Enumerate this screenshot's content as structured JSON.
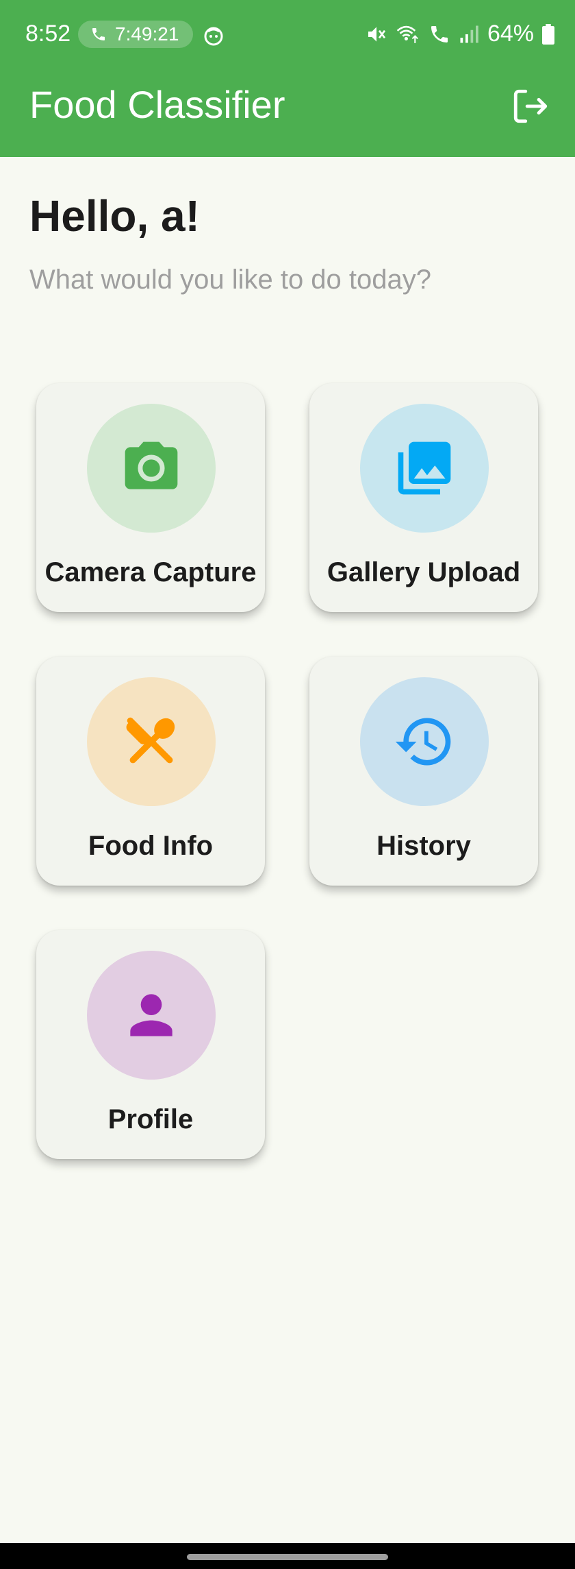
{
  "status_bar": {
    "time": "8:52",
    "call_timer": "7:49:21",
    "battery": "64%"
  },
  "app_bar": {
    "title": "Food Classifier",
    "logout_icon": "logout-icon"
  },
  "greeting": {
    "title": "Hello, a!",
    "subtitle": "What would you like to do today?"
  },
  "menu": [
    {
      "label": "Camera Capture",
      "icon": "camera-icon",
      "color": "#4caf50",
      "bg": "#d3e9d2"
    },
    {
      "label": "Gallery Upload",
      "icon": "photo-library-icon",
      "color": "#03a9f4",
      "bg": "#c7e6ef"
    },
    {
      "label": "Food Info",
      "icon": "restaurant-icon",
      "color": "#ff9800",
      "bg": "#f6e3c1"
    },
    {
      "label": "History",
      "icon": "history-icon",
      "color": "#2196f3",
      "bg": "#c9e1ef"
    },
    {
      "label": "Profile",
      "icon": "person-icon",
      "color": "#9c27b0",
      "bg": "#e2cde2"
    }
  ]
}
